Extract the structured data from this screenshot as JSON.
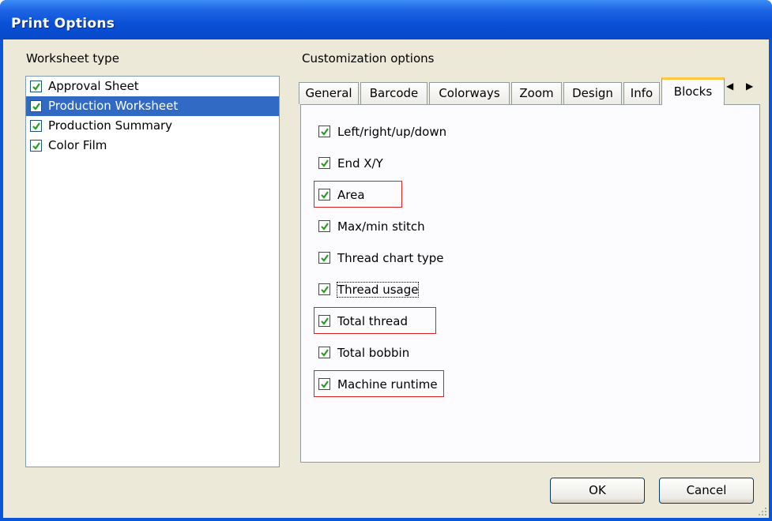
{
  "window": {
    "title": "Print Options"
  },
  "worksheet": {
    "label": "Worksheet type",
    "items": [
      {
        "label": "Approval Sheet",
        "checked": true,
        "selected": false
      },
      {
        "label": "Production Worksheet",
        "checked": true,
        "selected": true
      },
      {
        "label": "Production Summary",
        "checked": true,
        "selected": false
      },
      {
        "label": "Color Film",
        "checked": true,
        "selected": false
      }
    ]
  },
  "customization": {
    "label": "Customization options",
    "tabs": [
      "General",
      "Barcode",
      "Colorways",
      "Zoom",
      "Design",
      "Info",
      "Blocks"
    ],
    "active_tab": "Blocks",
    "scroll_arrows": "◀ ▶",
    "options": [
      {
        "label": "Left/right/up/down",
        "checked": true
      },
      {
        "label": "End X/Y",
        "checked": true
      },
      {
        "label": "Area",
        "checked": true,
        "highlighted": true
      },
      {
        "label": "Max/min stitch",
        "checked": true
      },
      {
        "label": "Thread chart type",
        "checked": true
      },
      {
        "label": "Thread usage",
        "checked": true,
        "focused": true
      },
      {
        "label": "Total thread",
        "checked": true,
        "highlighted": true
      },
      {
        "label": "Total bobbin",
        "checked": true
      },
      {
        "label": "Machine runtime",
        "checked": true,
        "highlighted": true
      }
    ]
  },
  "buttons": {
    "ok": "OK",
    "cancel": "Cancel"
  },
  "colors": {
    "title_bar": "#0a50d6",
    "selection": "#316ac5",
    "highlight_box": "#e02020",
    "check": "#21a121"
  }
}
